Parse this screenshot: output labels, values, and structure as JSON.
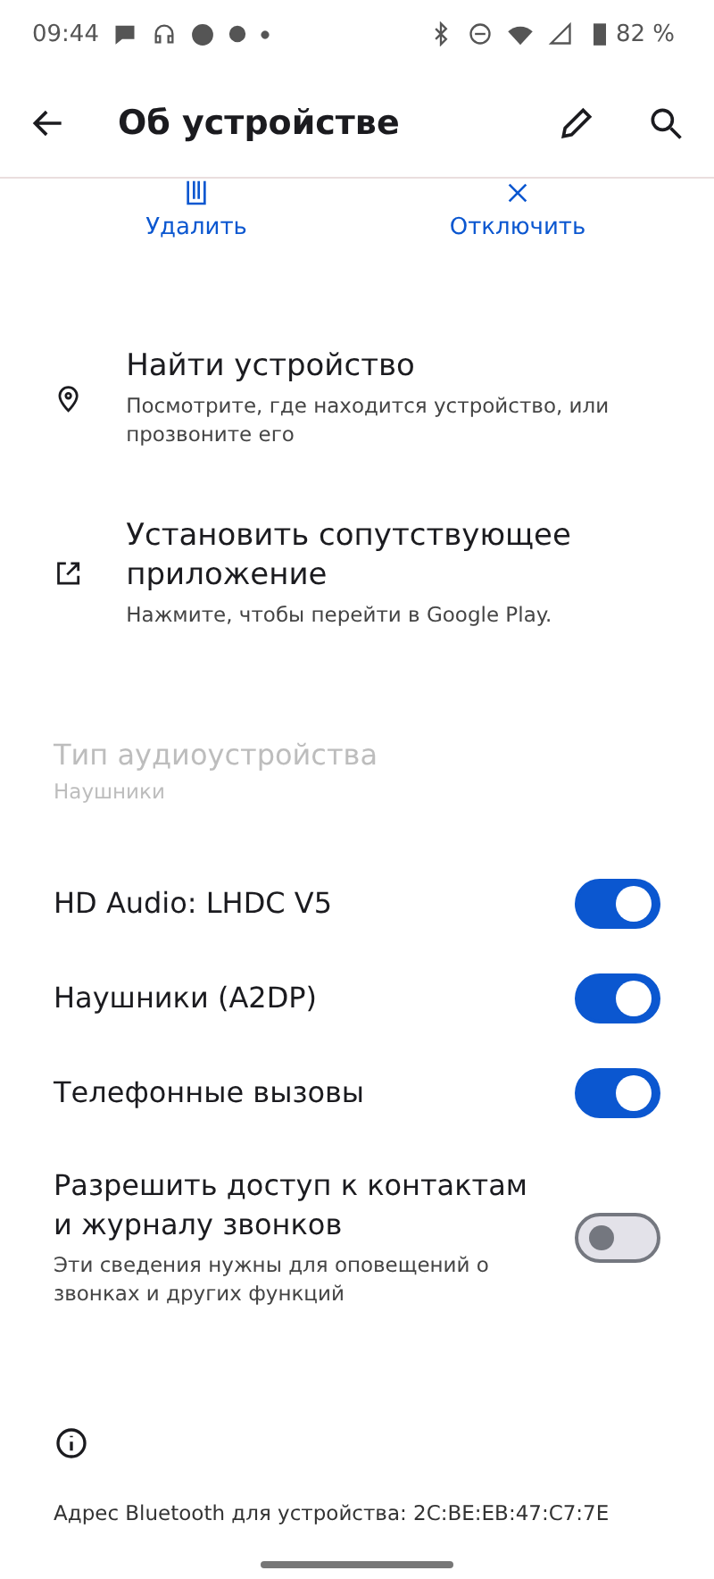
{
  "status_bar": {
    "time": "09:44",
    "battery": "82 %"
  },
  "app_bar": {
    "title": "Об устройстве"
  },
  "actions": [
    {
      "kind": "delete",
      "label": "Удалить"
    },
    {
      "kind": "disconnect",
      "label": "Отключить"
    }
  ],
  "links": [
    {
      "kind": "location",
      "title": "Найти устройство",
      "subtitle": "Посмотрите, где находится устройство, или прозвоните его"
    },
    {
      "kind": "external",
      "title": "Установить сопутствующее приложение",
      "subtitle": "Нажмите, чтобы перейти в Google Play."
    }
  ],
  "audio_type": {
    "title": "Тип аудиоустройства",
    "value": "Наушники",
    "disabled": true
  },
  "toggles": [
    {
      "title": "HD Audio: LHDC V5",
      "on": true
    },
    {
      "title": "Наушники (A2DP)",
      "on": true
    },
    {
      "title": "Телефонные вызовы",
      "on": true
    },
    {
      "title": "Разрешить доступ к контактам и журналу звонков",
      "subtitle": "Эти сведения нужны для оповещений о звонках и других функций",
      "on": false
    }
  ],
  "footer": {
    "address": "Адрес Bluetooth для устройства: 2C:BE:EB:47:C7:7E"
  }
}
